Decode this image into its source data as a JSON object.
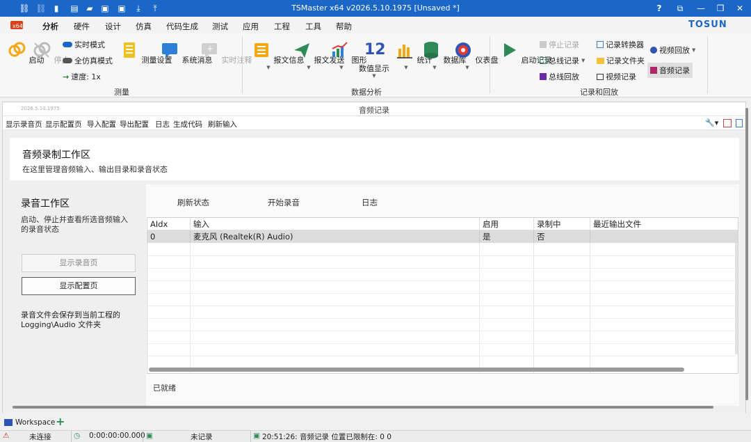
{
  "window": {
    "title": "TSMaster x64 v2026.5.10.1975 [Unsaved *]",
    "help": "?"
  },
  "menu": [
    "分析",
    "硬件",
    "设计",
    "仿真",
    "代码生成",
    "测试",
    "应用",
    "工程",
    "工具",
    "帮助"
  ],
  "brand": "TOSUN",
  "ribbon": {
    "measure": {
      "start": "启动",
      "stop": "停止",
      "realtime": "实时模式",
      "fullsim": "全仿真模式",
      "speed": "速度: 1x",
      "setup": "测量设置",
      "sysmsg": "系统消息",
      "annot": "实时注释",
      "group": "测量"
    },
    "analysis": {
      "msginfo": "报文信息",
      "msgsend": "报文发送",
      "graph": "图形",
      "numeric": "数值显示",
      "stats": "统计",
      "db": "数据库",
      "dashboard": "仪表盘",
      "numeric_icon": "12",
      "group": "数据分析"
    },
    "logging": {
      "startlog": "启动记录",
      "stoplog": "停止记录",
      "buslog": "总线记录",
      "busplay": "总线回放",
      "converter": "记录转换器",
      "folder": "记录文件夹",
      "videorec": "视频记录",
      "videoplay": "视频回放",
      "audiorec": "音频记录",
      "group": "记录和回放"
    }
  },
  "inner": {
    "version": "2026.5.10.1975",
    "title": "音频记录",
    "toolbar": [
      "显示录音页",
      "显示配置页",
      "导入配置",
      "导出配置",
      "日志",
      "生成代码",
      "刷新输入"
    ]
  },
  "header": {
    "title": "音频录制工作区",
    "subtitle": "在这里管理音频输入、输出目录和录音状态"
  },
  "left": {
    "title": "录音工作区",
    "desc": "启动、停止并查看所选音频输入的录音状态",
    "btn_record_page": "显示录音页",
    "btn_config_page": "显示配置页",
    "note": "录音文件会保存到当前工程的 Logging\\Audio 文件夹"
  },
  "tabs": [
    "刷新状态",
    "开始录音",
    "日志"
  ],
  "table": {
    "columns": [
      "AIdx",
      "输入",
      "启用",
      "录制中",
      "最近输出文件"
    ],
    "rows": [
      [
        "0",
        "麦克风 (Realtek(R) Audio)",
        "是",
        "否",
        ""
      ]
    ]
  },
  "status_text": "已就绪",
  "workspace": {
    "label": "Workspace",
    "add": "+"
  },
  "statusbar": {
    "conn": "未连接",
    "time": "0:00:00:00.000",
    "rec": "未记录",
    "msg": "20:51:26: 音频记录 位置已限制在: 0 0"
  }
}
